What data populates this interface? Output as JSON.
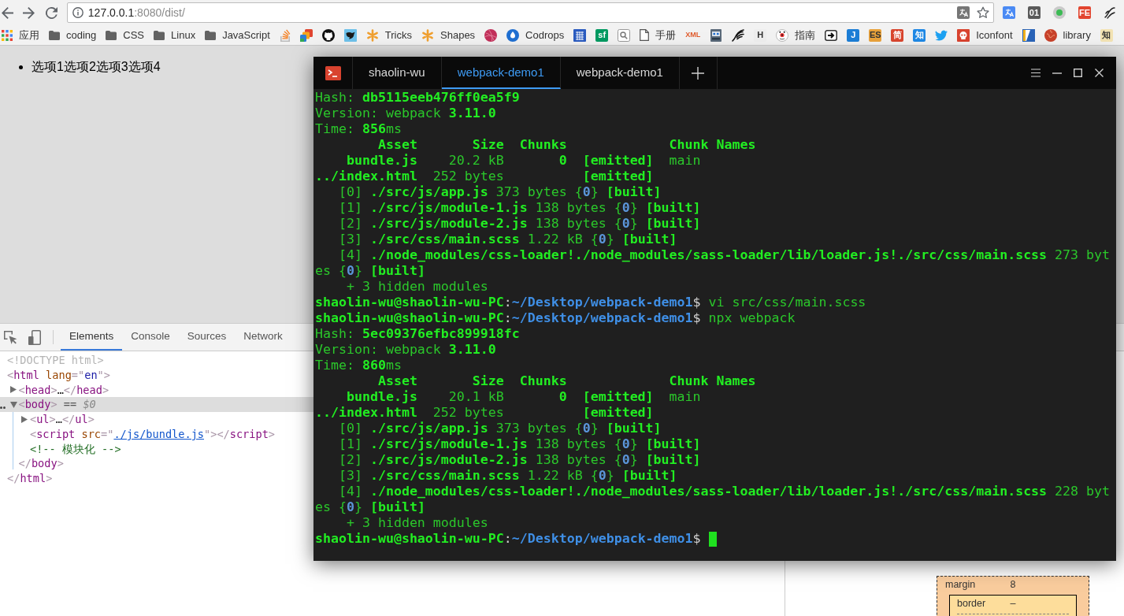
{
  "browser": {
    "address": {
      "host": "127.0.0.1",
      "rest": ":8080/dist/"
    },
    "extensions": [
      {
        "kind": "translate"
      },
      {
        "kind": "letter",
        "glyph": "01",
        "color": "#5a5a5a"
      },
      {
        "kind": "ring"
      },
      {
        "kind": "letter",
        "glyph": "FE",
        "color": "#e2452f"
      },
      {
        "kind": "script"
      }
    ],
    "bookmarks": [
      {
        "kind": "apps",
        "label": "应用"
      },
      {
        "kind": "folder",
        "label": "coding"
      },
      {
        "kind": "folder",
        "label": "CSS"
      },
      {
        "kind": "folder",
        "label": "Linux"
      },
      {
        "kind": "folder",
        "label": "JavaScript"
      },
      {
        "kind": "tray"
      },
      {
        "kind": "layers"
      },
      {
        "kind": "cat"
      },
      {
        "kind": "bird"
      },
      {
        "kind": "asterisk",
        "label": "Tricks"
      },
      {
        "kind": "asterisk",
        "label": "Shapes"
      },
      {
        "kind": "ball"
      },
      {
        "kind": "drop",
        "label": "Codrops"
      },
      {
        "kind": "pattern"
      },
      {
        "kind": "letter",
        "glyph": "sf",
        "color": "#009a61"
      },
      {
        "kind": "search"
      },
      {
        "kind": "page",
        "label": "手册"
      },
      {
        "kind": "wordmark",
        "glyph": "XML",
        "color": "#e05a2b"
      },
      {
        "kind": "robot"
      },
      {
        "kind": "feather"
      },
      {
        "kind": "letter",
        "glyph": "H",
        "color": "#eeeeee"
      },
      {
        "kind": "face",
        "label": "指南"
      },
      {
        "kind": "arrow"
      },
      {
        "kind": "letter",
        "glyph": "J",
        "color": "#1c7ed6"
      },
      {
        "kind": "letter",
        "glyph": "ES",
        "color": "#e9a23b"
      },
      {
        "kind": "letter",
        "glyph": "简",
        "color": "#d9462f"
      },
      {
        "kind": "letter",
        "glyph": "知",
        "color": "#1e88e5"
      },
      {
        "kind": "twitter"
      },
      {
        "kind": "skull",
        "label": "Iconfont"
      },
      {
        "kind": "split"
      },
      {
        "kind": "globe",
        "label": "library"
      },
      {
        "kind": "letter",
        "glyph": "知",
        "color": "#f3e3b3"
      }
    ]
  },
  "page": {
    "list_items": [
      "选项1选项2选项3选项4"
    ]
  },
  "devtools": {
    "tabs": [
      {
        "label": "Elements",
        "selected": true
      },
      {
        "label": "Console",
        "selected": false
      },
      {
        "label": "Sources",
        "selected": false
      },
      {
        "label": "Network",
        "selected": false
      }
    ],
    "dom_tree": [
      {
        "selected": false,
        "segments": [
          {
            "kind": "doctype",
            "text": "<!DOCTYPE html>"
          }
        ]
      },
      {
        "selected": false,
        "segments": [
          {
            "kind": "punct",
            "text": "<"
          },
          {
            "kind": "tag",
            "text": "html"
          },
          {
            "kind": "attr",
            "text": " lang"
          },
          {
            "kind": "punct",
            "text": "=\""
          },
          {
            "kind": "value",
            "text": "en"
          },
          {
            "kind": "punct",
            "text": "\">"
          }
        ],
        "children": [
          {
            "selected": false,
            "expanded": false,
            "segments": [
              {
                "kind": "punct",
                "text": "<"
              },
              {
                "kind": "tag",
                "text": "head"
              },
              {
                "kind": "punct",
                "text": ">"
              },
              {
                "kind": "text",
                "text": "…"
              },
              {
                "kind": "punct",
                "text": "</"
              },
              {
                "kind": "tag",
                "text": "head"
              },
              {
                "kind": "punct",
                "text": ">"
              }
            ]
          },
          {
            "selected": true,
            "expanded": true,
            "segments": [
              {
                "kind": "punct",
                "text": "<"
              },
              {
                "kind": "tag",
                "text": "body"
              },
              {
                "kind": "punct",
                "text": ">"
              },
              {
                "kind": "plain",
                "text": " == "
              },
              {
                "kind": "ref",
                "text": "$0"
              }
            ],
            "children": [
              {
                "selected": false,
                "expanded": false,
                "segments": [
                  {
                    "kind": "punct",
                    "text": "<"
                  },
                  {
                    "kind": "tag",
                    "text": "ul"
                  },
                  {
                    "kind": "punct",
                    "text": ">"
                  },
                  {
                    "kind": "text",
                    "text": "…"
                  },
                  {
                    "kind": "punct",
                    "text": "</"
                  },
                  {
                    "kind": "tag",
                    "text": "ul"
                  },
                  {
                    "kind": "punct",
                    "text": ">"
                  }
                ]
              },
              {
                "selected": false,
                "segments": [
                  {
                    "kind": "punct",
                    "text": "<"
                  },
                  {
                    "kind": "tag",
                    "text": "script"
                  },
                  {
                    "kind": "attr",
                    "text": " src"
                  },
                  {
                    "kind": "punct",
                    "text": "=\""
                  },
                  {
                    "kind": "link",
                    "text": "./js/bundle.js"
                  },
                  {
                    "kind": "punct",
                    "text": "\">"
                  },
                  {
                    "kind": "punct",
                    "text": "</"
                  },
                  {
                    "kind": "tag",
                    "text": "script"
                  },
                  {
                    "kind": "punct",
                    "text": ">"
                  }
                ]
              },
              {
                "selected": false,
                "segments": [
                  {
                    "kind": "comment",
                    "text": "<!-- 模块化 -->"
                  }
                ]
              }
            ],
            "closing": [
              {
                "kind": "punct",
                "text": "</"
              },
              {
                "kind": "tag",
                "text": "body"
              },
              {
                "kind": "punct",
                "text": ">"
              }
            ]
          }
        ],
        "closing": [
          {
            "kind": "punct",
            "text": "</"
          },
          {
            "kind": "tag",
            "text": "html"
          },
          {
            "kind": "punct",
            "text": ">"
          }
        ]
      }
    ],
    "box_model": {
      "margin": {
        "label": "margin",
        "value": "8"
      },
      "border": {
        "label": "border",
        "value": "–"
      }
    }
  },
  "terminal": {
    "tabs": [
      {
        "label": "shaolin-wu",
        "selected": false
      },
      {
        "label": "webpack-demo1",
        "selected": true
      },
      {
        "label": "webpack-demo1",
        "selected": false
      }
    ],
    "cursor": true,
    "lines": [
      {
        "segments": [
          {
            "kind": "normal",
            "text": "Hash: "
          },
          {
            "kind": "bold",
            "text": "db5115eeb476ff0ea5f9"
          }
        ]
      },
      {
        "segments": [
          {
            "kind": "normal",
            "text": "Version: webpack "
          },
          {
            "kind": "bold",
            "text": "3.11.0"
          }
        ]
      },
      {
        "segments": [
          {
            "kind": "normal",
            "text": "Time: "
          },
          {
            "kind": "bold",
            "text": "856"
          },
          {
            "kind": "normal",
            "text": "ms"
          }
        ]
      },
      {
        "segments": [
          {
            "kind": "bold",
            "text": "        Asset       Size  Chunks             Chunk Names"
          }
        ]
      },
      {
        "segments": [
          {
            "kind": "bold",
            "text": "    bundle.js"
          },
          {
            "kind": "normal",
            "text": "    20.2 kB"
          },
          {
            "kind": "bold",
            "text": "       0  [emitted]"
          },
          {
            "kind": "normal",
            "text": "  main"
          }
        ]
      },
      {
        "segments": [
          {
            "kind": "bold",
            "text": "../index.html"
          },
          {
            "kind": "normal",
            "text": "  252 bytes"
          },
          {
            "kind": "bold",
            "text": "          [emitted]"
          }
        ]
      },
      {
        "segments": [
          {
            "kind": "normal",
            "text": "   [0] "
          },
          {
            "kind": "bold",
            "text": "./src/js/app.js"
          },
          {
            "kind": "normal",
            "text": " 373 bytes {"
          },
          {
            "kind": "number",
            "text": "0"
          },
          {
            "kind": "normal",
            "text": "} "
          },
          {
            "kind": "bold",
            "text": "[built]"
          }
        ]
      },
      {
        "segments": [
          {
            "kind": "normal",
            "text": "   [1] "
          },
          {
            "kind": "bold",
            "text": "./src/js/module-1.js"
          },
          {
            "kind": "normal",
            "text": " 138 bytes {"
          },
          {
            "kind": "number",
            "text": "0"
          },
          {
            "kind": "normal",
            "text": "} "
          },
          {
            "kind": "bold",
            "text": "[built]"
          }
        ]
      },
      {
        "segments": [
          {
            "kind": "normal",
            "text": "   [2] "
          },
          {
            "kind": "bold",
            "text": "./src/js/module-2.js"
          },
          {
            "kind": "normal",
            "text": " 138 bytes {"
          },
          {
            "kind": "number",
            "text": "0"
          },
          {
            "kind": "normal",
            "text": "} "
          },
          {
            "kind": "bold",
            "text": "[built]"
          }
        ]
      },
      {
        "segments": [
          {
            "kind": "normal",
            "text": "   [3] "
          },
          {
            "kind": "bold",
            "text": "./src/css/main.scss"
          },
          {
            "kind": "normal",
            "text": " 1.22 kB {"
          },
          {
            "kind": "number",
            "text": "0"
          },
          {
            "kind": "normal",
            "text": "} "
          },
          {
            "kind": "bold",
            "text": "[built]"
          }
        ]
      },
      {
        "segments": [
          {
            "kind": "normal",
            "text": "   [4] "
          },
          {
            "kind": "bold",
            "text": "./node_modules/css-loader!./node_modules/sass-loader/lib/loader.js!./src/css/main.scss"
          },
          {
            "kind": "normal",
            "text": " 273 byt"
          }
        ]
      },
      {
        "segments": [
          {
            "kind": "normal",
            "text": "es {"
          },
          {
            "kind": "number",
            "text": "0"
          },
          {
            "kind": "normal",
            "text": "} "
          },
          {
            "kind": "bold",
            "text": "[built]"
          }
        ]
      },
      {
        "segments": [
          {
            "kind": "normal",
            "text": "    + 3 hidden modules"
          }
        ]
      },
      {
        "segments": [
          {
            "kind": "bold",
            "text": "shaolin-wu@shaolin-wu-PC"
          },
          {
            "kind": "plain",
            "text": ":"
          },
          {
            "kind": "path",
            "text": "~/Desktop/webpack-demo1"
          },
          {
            "kind": "plain",
            "text": "$"
          },
          {
            "kind": "normal",
            "text": " vi src/css/main.scss"
          }
        ]
      },
      {
        "segments": [
          {
            "kind": "bold",
            "text": "shaolin-wu@shaolin-wu-PC"
          },
          {
            "kind": "plain",
            "text": ":"
          },
          {
            "kind": "path",
            "text": "~/Desktop/webpack-demo1"
          },
          {
            "kind": "plain",
            "text": "$"
          },
          {
            "kind": "normal",
            "text": " npx webpack"
          }
        ]
      },
      {
        "segments": [
          {
            "kind": "normal",
            "text": "Hash: "
          },
          {
            "kind": "bold",
            "text": "5ec09376efbc899918fc"
          }
        ]
      },
      {
        "segments": [
          {
            "kind": "normal",
            "text": "Version: webpack "
          },
          {
            "kind": "bold",
            "text": "3.11.0"
          }
        ]
      },
      {
        "segments": [
          {
            "kind": "normal",
            "text": "Time: "
          },
          {
            "kind": "bold",
            "text": "860"
          },
          {
            "kind": "normal",
            "text": "ms"
          }
        ]
      },
      {
        "segments": [
          {
            "kind": "bold",
            "text": "        Asset       Size  Chunks             Chunk Names"
          }
        ]
      },
      {
        "segments": [
          {
            "kind": "bold",
            "text": "    bundle.js"
          },
          {
            "kind": "normal",
            "text": "    20.1 kB"
          },
          {
            "kind": "bold",
            "text": "       0  [emitted]"
          },
          {
            "kind": "normal",
            "text": "  main"
          }
        ]
      },
      {
        "segments": [
          {
            "kind": "bold",
            "text": "../index.html"
          },
          {
            "kind": "normal",
            "text": "  252 bytes"
          },
          {
            "kind": "bold",
            "text": "          [emitted]"
          }
        ]
      },
      {
        "segments": [
          {
            "kind": "normal",
            "text": "   [0] "
          },
          {
            "kind": "bold",
            "text": "./src/js/app.js"
          },
          {
            "kind": "normal",
            "text": " 373 bytes {"
          },
          {
            "kind": "number",
            "text": "0"
          },
          {
            "kind": "normal",
            "text": "} "
          },
          {
            "kind": "bold",
            "text": "[built]"
          }
        ]
      },
      {
        "segments": [
          {
            "kind": "normal",
            "text": "   [1] "
          },
          {
            "kind": "bold",
            "text": "./src/js/module-1.js"
          },
          {
            "kind": "normal",
            "text": " 138 bytes {"
          },
          {
            "kind": "number",
            "text": "0"
          },
          {
            "kind": "normal",
            "text": "} "
          },
          {
            "kind": "bold",
            "text": "[built]"
          }
        ]
      },
      {
        "segments": [
          {
            "kind": "normal",
            "text": "   [2] "
          },
          {
            "kind": "bold",
            "text": "./src/js/module-2.js"
          },
          {
            "kind": "normal",
            "text": " 138 bytes {"
          },
          {
            "kind": "number",
            "text": "0"
          },
          {
            "kind": "normal",
            "text": "} "
          },
          {
            "kind": "bold",
            "text": "[built]"
          }
        ]
      },
      {
        "segments": [
          {
            "kind": "normal",
            "text": "   [3] "
          },
          {
            "kind": "bold",
            "text": "./src/css/main.scss"
          },
          {
            "kind": "normal",
            "text": " 1.22 kB {"
          },
          {
            "kind": "number",
            "text": "0"
          },
          {
            "kind": "normal",
            "text": "} "
          },
          {
            "kind": "bold",
            "text": "[built]"
          }
        ]
      },
      {
        "segments": [
          {
            "kind": "normal",
            "text": "   [4] "
          },
          {
            "kind": "bold",
            "text": "./node_modules/css-loader!./node_modules/sass-loader/lib/loader.js!./src/css/main.scss"
          },
          {
            "kind": "normal",
            "text": " 228 byt"
          }
        ]
      },
      {
        "segments": [
          {
            "kind": "normal",
            "text": "es {"
          },
          {
            "kind": "number",
            "text": "0"
          },
          {
            "kind": "normal",
            "text": "} "
          },
          {
            "kind": "bold",
            "text": "[built]"
          }
        ]
      },
      {
        "segments": [
          {
            "kind": "normal",
            "text": "    + 3 hidden modules"
          }
        ]
      },
      {
        "segments": [
          {
            "kind": "bold",
            "text": "shaolin-wu@shaolin-wu-PC"
          },
          {
            "kind": "plain",
            "text": ":"
          },
          {
            "kind": "path",
            "text": "~/Desktop/webpack-demo1"
          },
          {
            "kind": "plain",
            "text": "$"
          }
        ]
      }
    ]
  }
}
